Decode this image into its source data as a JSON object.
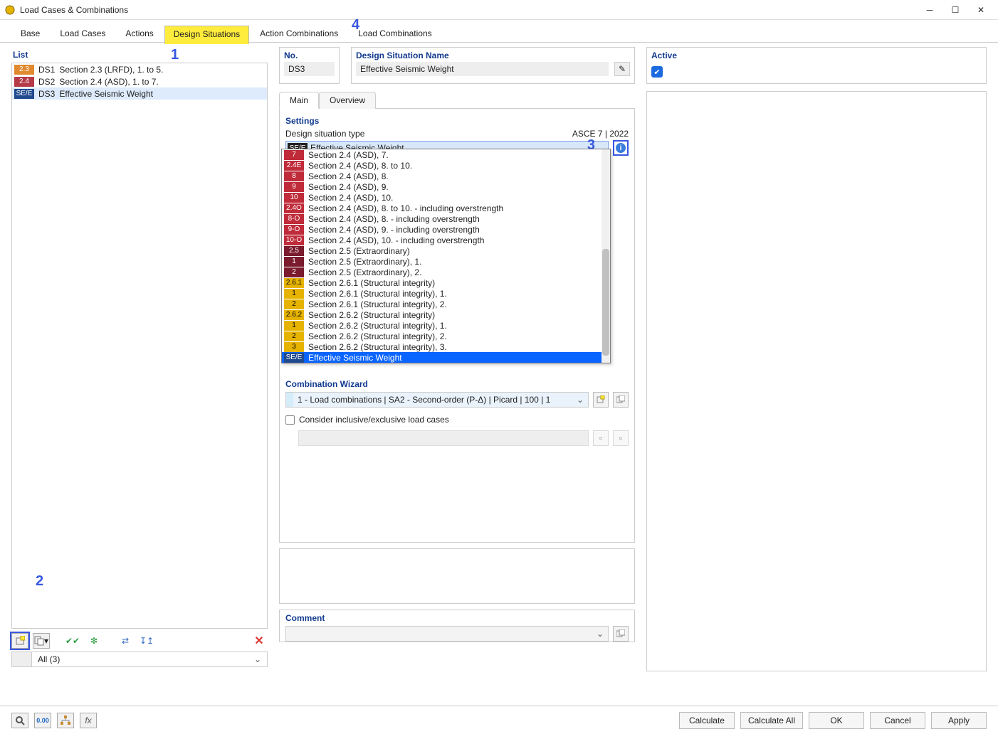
{
  "window": {
    "title": "Load Cases & Combinations"
  },
  "tabs": [
    "Base",
    "Load Cases",
    "Actions",
    "Design Situations",
    "Action Combinations",
    "Load Combinations"
  ],
  "active_tab_index": 3,
  "annotations": {
    "a1": "1",
    "a2": "2",
    "a3": "3",
    "a4": "4"
  },
  "left": {
    "header": "List",
    "rows": [
      {
        "badge": "2.3",
        "color": "#e0892f",
        "ds": "DS1",
        "label": "Section 2.3 (LRFD), 1. to 5."
      },
      {
        "badge": "2.4",
        "color": "#b53947",
        "ds": "DS2",
        "label": "Section 2.4 (ASD), 1. to 7."
      },
      {
        "badge": "SE/E",
        "color": "#204a8f",
        "ds": "DS3",
        "label": "Effective Seismic Weight",
        "selected": true
      }
    ],
    "filter": "All (3)"
  },
  "form": {
    "no_label": "No.",
    "no_value": "DS3",
    "name_label": "Design Situation Name",
    "name_value": "Effective Seismic Weight",
    "active_label": "Active"
  },
  "subtabs": {
    "main": "Main",
    "overview": "Overview"
  },
  "settings": {
    "header": "Settings",
    "dst_label": "Design situation type",
    "standard": "ASCE 7 | 2022",
    "selected_badge": "SE/E",
    "selected_text": "Effective Seismic Weight",
    "wizard_header": "Combination Wizard",
    "wizard_value": "1 - Load combinations | SA2 - Second-order (P-Δ) | Picard | 100 | 1",
    "consider_label": "Consider inclusive/exclusive load cases"
  },
  "comment": {
    "header": "Comment"
  },
  "dropdown": [
    {
      "badge": "7",
      "color": "#c02b3a",
      "label": "Section 2.4 (ASD), 7."
    },
    {
      "badge": "2.4E",
      "color": "#c02b3a",
      "label": "Section 2.4 (ASD), 8. to 10."
    },
    {
      "badge": "8",
      "color": "#c02b3a",
      "label": "Section 2.4 (ASD), 8."
    },
    {
      "badge": "9",
      "color": "#c02b3a",
      "label": "Section 2.4 (ASD), 9."
    },
    {
      "badge": "10",
      "color": "#c02b3a",
      "label": "Section 2.4 (ASD), 10."
    },
    {
      "badge": "2.4O",
      "color": "#c02b3a",
      "label": "Section 2.4 (ASD), 8. to 10. - including overstrength"
    },
    {
      "badge": "8-O",
      "color": "#c02b3a",
      "label": "Section 2.4 (ASD), 8. - including overstrength"
    },
    {
      "badge": "9-O",
      "color": "#c02b3a",
      "label": "Section 2.4 (ASD), 9. - including overstrength"
    },
    {
      "badge": "10-O",
      "color": "#c02b3a",
      "label": "Section 2.4 (ASD), 10. - including overstrength"
    },
    {
      "badge": "2.5",
      "color": "#7a1b2e",
      "label": "Section 2.5 (Extraordinary)"
    },
    {
      "badge": "1",
      "color": "#7a1b2e",
      "label": "Section 2.5 (Extraordinary), 1."
    },
    {
      "badge": "2",
      "color": "#7a1b2e",
      "label": "Section 2.5 (Extraordinary), 2."
    },
    {
      "badge": "2.6.1",
      "color": "#e6b400",
      "label": "Section 2.6.1 (Structural integrity)"
    },
    {
      "badge": "1",
      "color": "#e6b400",
      "label": "Section 2.6.1 (Structural integrity), 1."
    },
    {
      "badge": "2",
      "color": "#e6b400",
      "label": "Section 2.6.1 (Structural integrity), 2."
    },
    {
      "badge": "2.6.2",
      "color": "#e6b400",
      "label": "Section 2.6.2 (Structural integrity)"
    },
    {
      "badge": "1",
      "color": "#e6b400",
      "label": "Section 2.6.2 (Structural integrity), 1."
    },
    {
      "badge": "2",
      "color": "#e6b400",
      "label": "Section 2.6.2 (Structural integrity), 2."
    },
    {
      "badge": "3",
      "color": "#e6b400",
      "label": "Section 2.6.2 (Structural integrity), 3."
    },
    {
      "badge": "SE/E",
      "color": "#204a8f",
      "label": "Effective Seismic Weight",
      "hover": true
    }
  ],
  "footer": {
    "calculate": "Calculate",
    "calculate_all": "Calculate All",
    "ok": "OK",
    "cancel": "Cancel",
    "apply": "Apply"
  }
}
